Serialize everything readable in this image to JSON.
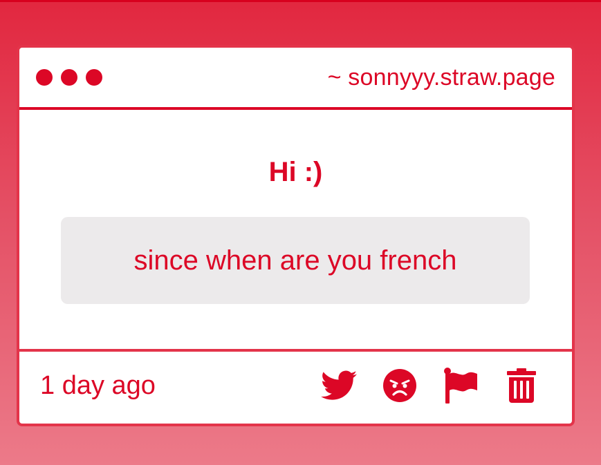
{
  "window": {
    "controls": [
      "dot",
      "dot",
      "dot"
    ],
    "url": "~ sonnyyy.straw.page"
  },
  "question": {
    "title": "Hi :)",
    "message": "since when are you french"
  },
  "footer": {
    "time": "1 day ago",
    "actions": [
      {
        "icon": "twitter-icon",
        "action": "share-twitter"
      },
      {
        "icon": "angry-face-icon",
        "action": "react"
      },
      {
        "icon": "flag-icon",
        "action": "report"
      },
      {
        "icon": "trash-icon",
        "action": "delete"
      }
    ]
  },
  "colors": {
    "accent": "#dc0726",
    "background_top": "#e2273f",
    "background_bottom": "#ec7a89",
    "message_bg": "#eceaeb"
  }
}
